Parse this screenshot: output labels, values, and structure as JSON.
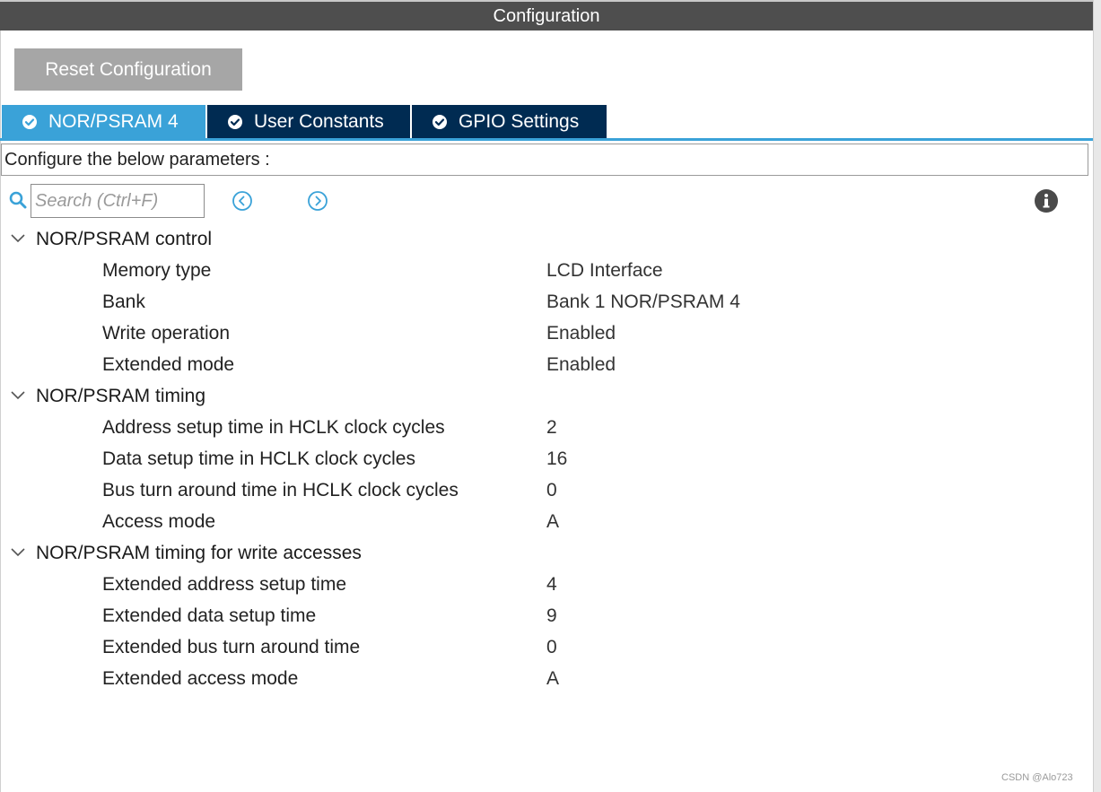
{
  "window": {
    "title": "Configuration"
  },
  "toolbar": {
    "reset_label": "Reset Configuration"
  },
  "tabs": [
    {
      "label": "NOR/PSRAM 4",
      "active": true
    },
    {
      "label": "User Constants",
      "active": false
    },
    {
      "label": "GPIO Settings",
      "active": false
    }
  ],
  "params_hint": "Configure the below parameters :",
  "search": {
    "placeholder": "Search (Ctrl+F)",
    "value": ""
  },
  "groups": [
    {
      "title": "NOR/PSRAM control",
      "rows": [
        {
          "name": "Memory type",
          "value": "LCD Interface"
        },
        {
          "name": "Bank",
          "value": "Bank 1 NOR/PSRAM 4"
        },
        {
          "name": "Write operation",
          "value": "Enabled"
        },
        {
          "name": "Extended mode",
          "value": "Enabled"
        }
      ]
    },
    {
      "title": "NOR/PSRAM timing",
      "rows": [
        {
          "name": "Address setup time in HCLK clock cycles",
          "value": "2"
        },
        {
          "name": "Data setup time in HCLK clock cycles",
          "value": "16"
        },
        {
          "name": "Bus turn around time in HCLK clock cycles",
          "value": "0"
        },
        {
          "name": "Access mode",
          "value": "A"
        }
      ]
    },
    {
      "title": "NOR/PSRAM timing for write accesses",
      "rows": [
        {
          "name": "Extended address setup time",
          "value": "4"
        },
        {
          "name": "Extended data setup time",
          "value": "9"
        },
        {
          "name": "Extended bus turn around time",
          "value": "0"
        },
        {
          "name": "Extended access mode",
          "value": "A"
        }
      ]
    }
  ],
  "watermark": "CSDN @Alo723",
  "colors": {
    "title_bar": "#4e4e4e",
    "tab_active": "#3aa2d8",
    "tab_inactive": "#002b52",
    "reset_button": "#a6a6a6",
    "accent_icon": "#3aa2d8"
  }
}
